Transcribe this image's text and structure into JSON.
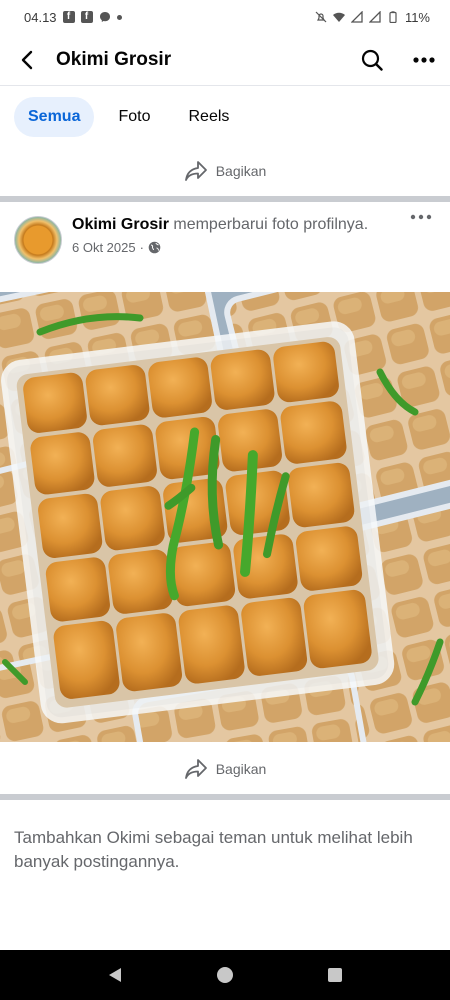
{
  "status_bar": {
    "time": "04.13",
    "battery": "11%"
  },
  "header": {
    "title": "Okimi Grosir"
  },
  "tabs": [
    {
      "label": "Semua",
      "active": true
    },
    {
      "label": "Foto",
      "active": false
    },
    {
      "label": "Reels",
      "active": false
    }
  ],
  "share_label": "Bagikan",
  "post": {
    "author": "Okimi Grosir",
    "action": "memperbarui foto profilnya.",
    "date": "6 Okt 2025",
    "share_label": "Bagikan"
  },
  "suggestion": "Tambahkan Okimi sebagai teman untuk melihat lebih banyak postingannya.",
  "colors": {
    "accent": "#0a66d8",
    "tab_active_bg": "#e7f0fd",
    "divider": "#c9ccd1",
    "tofu": "#dc9132"
  },
  "icons": [
    "back-arrow-icon",
    "search-icon",
    "more-icon",
    "share-icon",
    "globe-icon",
    "nav-back-icon",
    "nav-home-icon",
    "nav-recents-icon"
  ]
}
